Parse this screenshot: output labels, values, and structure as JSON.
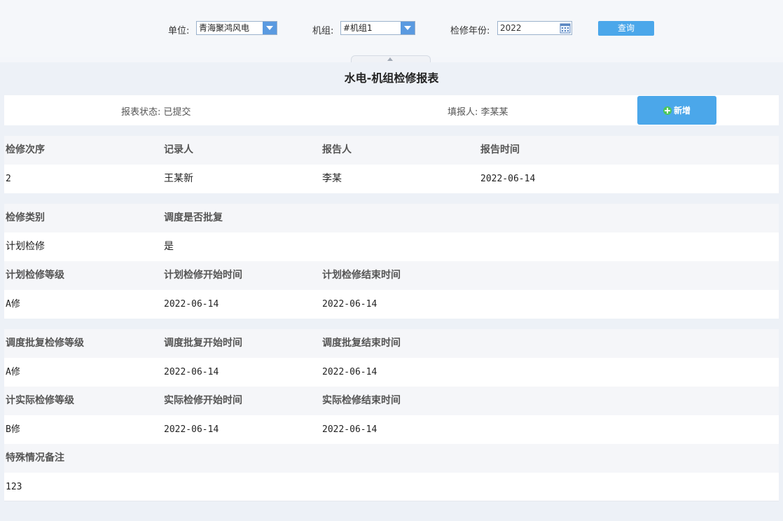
{
  "filters": {
    "unit_label": "单位:",
    "unit_value": "青海聚鸿风电",
    "machine_label": "机组:",
    "machine_value": "#机组1",
    "year_label": "检修年份:",
    "year_value": "2022",
    "query_label": "查询"
  },
  "report": {
    "title": "水电-机组检修报表",
    "status": "报表状态: 已提交",
    "reporter": "填报人: 李某某",
    "add_label": "新增",
    "section1": {
      "headers": [
        "检修次序",
        "记录人",
        "报告人",
        "报告时间"
      ],
      "values": [
        "2",
        "王某新",
        "李某",
        "2022-06-14"
      ]
    },
    "section2": {
      "headers": [
        "检修类别",
        "调度是否批复"
      ],
      "values": [
        "计划检修",
        "是"
      ]
    },
    "section3": {
      "headers": [
        "计划检修等级",
        "计划检修开始时间",
        "计划检修结束时间"
      ],
      "values": [
        "A修",
        "2022-06-14",
        "2022-06-14"
      ]
    },
    "section4": {
      "headers": [
        "调度批复检修等级",
        "调度批复开始时间",
        "调度批复结束时间"
      ],
      "values": [
        "A修",
        "2022-06-14",
        "2022-06-14"
      ]
    },
    "section5": {
      "headers": [
        "计实际检修等级",
        "实际检修开始时间",
        "实际检修结束时间"
      ],
      "values": [
        "B修",
        "2022-06-14",
        "2022-06-14"
      ]
    },
    "section6": {
      "headers": [
        "特殊情况备注"
      ],
      "values": [
        "123"
      ]
    }
  },
  "icons": {
    "calendar": "calendar-icon",
    "dropdown": "chevron-down-icon",
    "add": "plus-circle-icon",
    "collapse": "collapse-up-icon"
  },
  "colors": {
    "accent": "#4ba7ea",
    "add_icon": "#4cc75a",
    "header_band": "#f5f6f9"
  }
}
